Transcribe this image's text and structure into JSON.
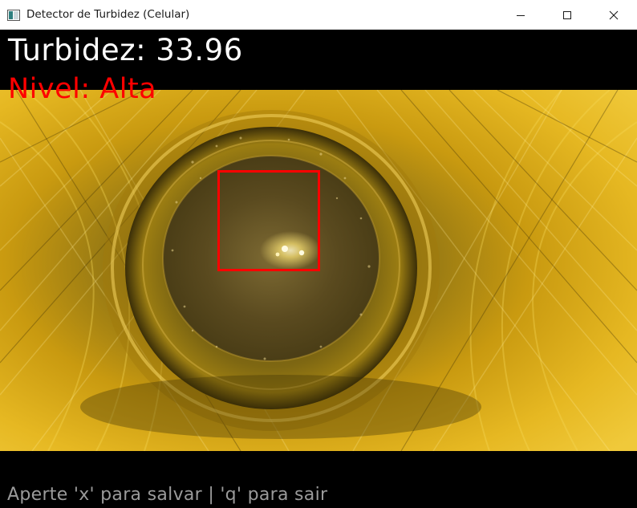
{
  "window": {
    "title": "Detector de Turbidez (Celular)",
    "icon": "opencv-window-icon",
    "controls": {
      "minimize": "minimize-icon",
      "maximize": "maximize-icon",
      "close": "close-icon"
    }
  },
  "overlay": {
    "turbidity": "Turbidez: 33.96",
    "level": "Nivel: Alta",
    "hint": "Aperte 'x' para salvar | 'q' para sair"
  },
  "colors": {
    "turbidity_text": "#ffffff",
    "level_text": "#ff0000",
    "roi_box": "#ff0000",
    "hint_text": "#9a9a9a",
    "liquid_tint": "#c9a21a"
  }
}
